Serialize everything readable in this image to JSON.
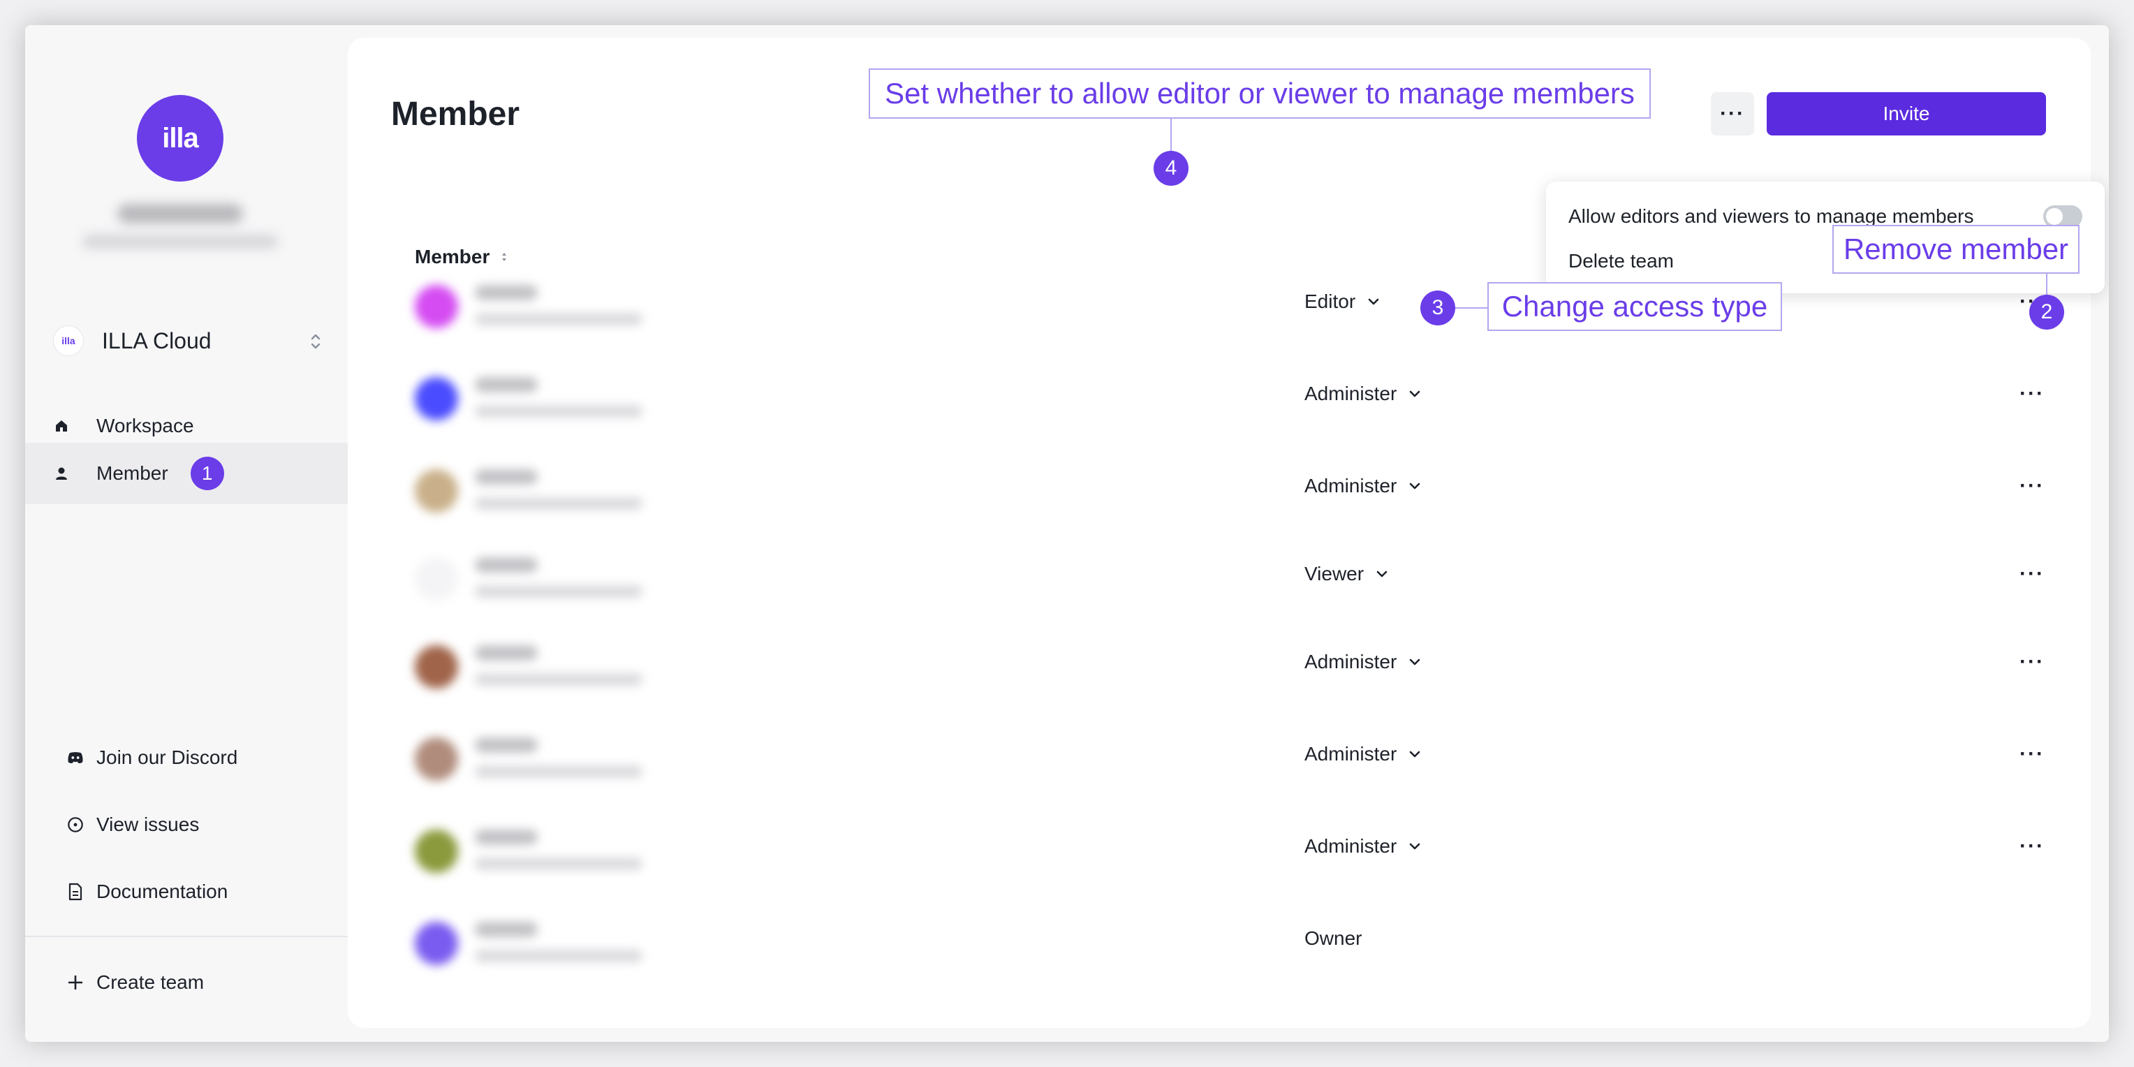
{
  "sidebar": {
    "team": {
      "logo_text": "illa",
      "name": "ILLA Cloud"
    },
    "nav": [
      {
        "label": "Workspace",
        "icon": "home-icon"
      },
      {
        "label": "Member",
        "icon": "person-icon",
        "badge": "1"
      }
    ],
    "links": [
      {
        "label": "Join our Discord",
        "icon": "discord-icon"
      },
      {
        "label": "View issues",
        "icon": "issue-circle-icon"
      },
      {
        "label": "Documentation",
        "icon": "document-icon"
      }
    ],
    "create_team": "Create team",
    "brand_logo": "illa"
  },
  "main": {
    "title": "Member",
    "more_label": "···",
    "invite_label": "Invite",
    "column_header": "Member",
    "members": [
      {
        "role": "Editor",
        "has_dropdown": true,
        "has_more": true,
        "avatar_color": "#d54cf2"
      },
      {
        "role": "Administer",
        "has_dropdown": true,
        "has_more": true,
        "avatar_color": "#4a4cff"
      },
      {
        "role": "Administer",
        "has_dropdown": true,
        "has_more": true,
        "avatar_color": "#c9b08a"
      },
      {
        "role": "Viewer",
        "has_dropdown": true,
        "has_more": true,
        "avatar_color": "#f4f4f6"
      },
      {
        "role": "Administer",
        "has_dropdown": true,
        "has_more": true,
        "avatar_color": "#a0644a"
      },
      {
        "role": "Administer",
        "has_dropdown": true,
        "has_more": true,
        "avatar_color": "#b08c7c"
      },
      {
        "role": "Administer",
        "has_dropdown": true,
        "has_more": true,
        "avatar_color": "#8a9a3c"
      },
      {
        "role": "Owner",
        "has_dropdown": false,
        "has_more": false,
        "avatar_color": "#7a5cf0"
      }
    ]
  },
  "dropdown": {
    "allow_label": "Allow editors and viewers to manage members",
    "allow_enabled": false,
    "delete_label": "Delete team"
  },
  "annotations": {
    "a1": "1",
    "a2": {
      "num": "2",
      "text": "Remove member"
    },
    "a3": {
      "num": "3",
      "text": "Change access type"
    },
    "a4": {
      "num": "4",
      "text": "Set whether to allow editor or viewer to manage members"
    }
  },
  "colors": {
    "accent": "#6a3de8",
    "primary_button": "#5b2be0",
    "annotation_border": "#b3a6f0"
  }
}
